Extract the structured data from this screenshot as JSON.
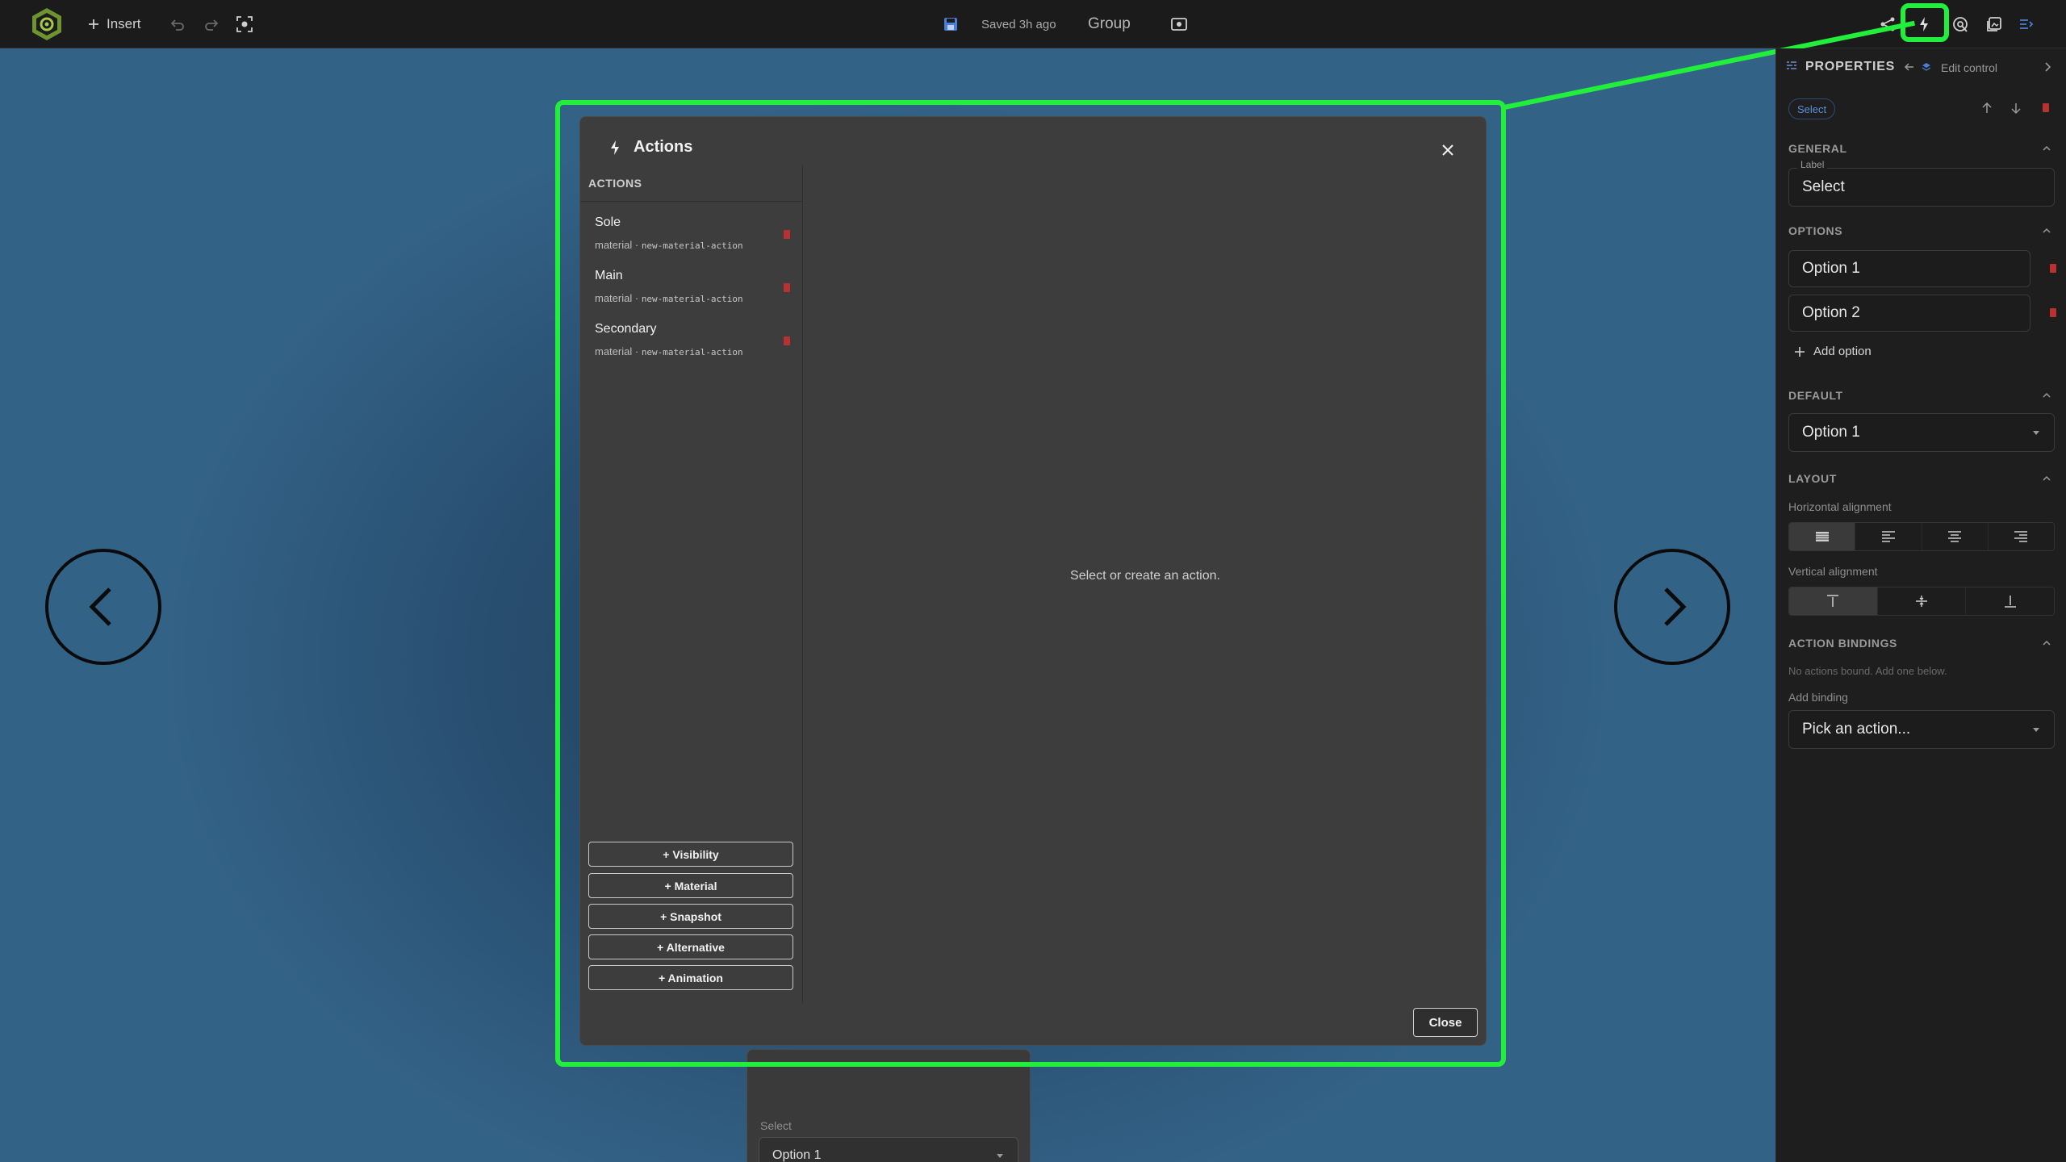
{
  "topbar": {
    "insert_label": "Insert",
    "saved_label": "Saved 3h ago",
    "group_label": "Group"
  },
  "modal": {
    "title": "Actions",
    "actions_heading": "ACTIONS",
    "actions": [
      {
        "name": "Sole",
        "type": "material",
        "id": "new-material-action"
      },
      {
        "name": "Main",
        "type": "material",
        "id": "new-material-action"
      },
      {
        "name": "Secondary",
        "type": "material",
        "id": "new-material-action"
      }
    ],
    "add_buttons": [
      "+ Visibility",
      "+ Material",
      "+ Snapshot",
      "+ Alternative",
      "+ Animation"
    ],
    "empty_message": "Select or create an action.",
    "close_label": "Close"
  },
  "preview": {
    "label": "Select",
    "value": "Option 1"
  },
  "panel": {
    "title": "PROPERTIES",
    "edit_control": "Edit control",
    "chip": "Select",
    "general_title": "GENERAL",
    "label_caption": "Label",
    "label_value": "Select",
    "options_title": "OPTIONS",
    "options": [
      "Option 1",
      "Option 2"
    ],
    "add_option": "Add option",
    "default_title": "DEFAULT",
    "default_value": "Option 1",
    "layout_title": "LAYOUT",
    "horizontal_label": "Horizontal alignment",
    "vertical_label": "Vertical alignment",
    "bindings_title": "ACTION BINDINGS",
    "no_bindings": "No actions bound. Add one below.",
    "add_binding_label": "Add binding",
    "binding_placeholder": "Pick an action..."
  },
  "colors": {
    "highlight": "#22ee3c",
    "delete": "#b83232",
    "accent_blue": "#4a7fd4",
    "logo": "#8fb339"
  }
}
